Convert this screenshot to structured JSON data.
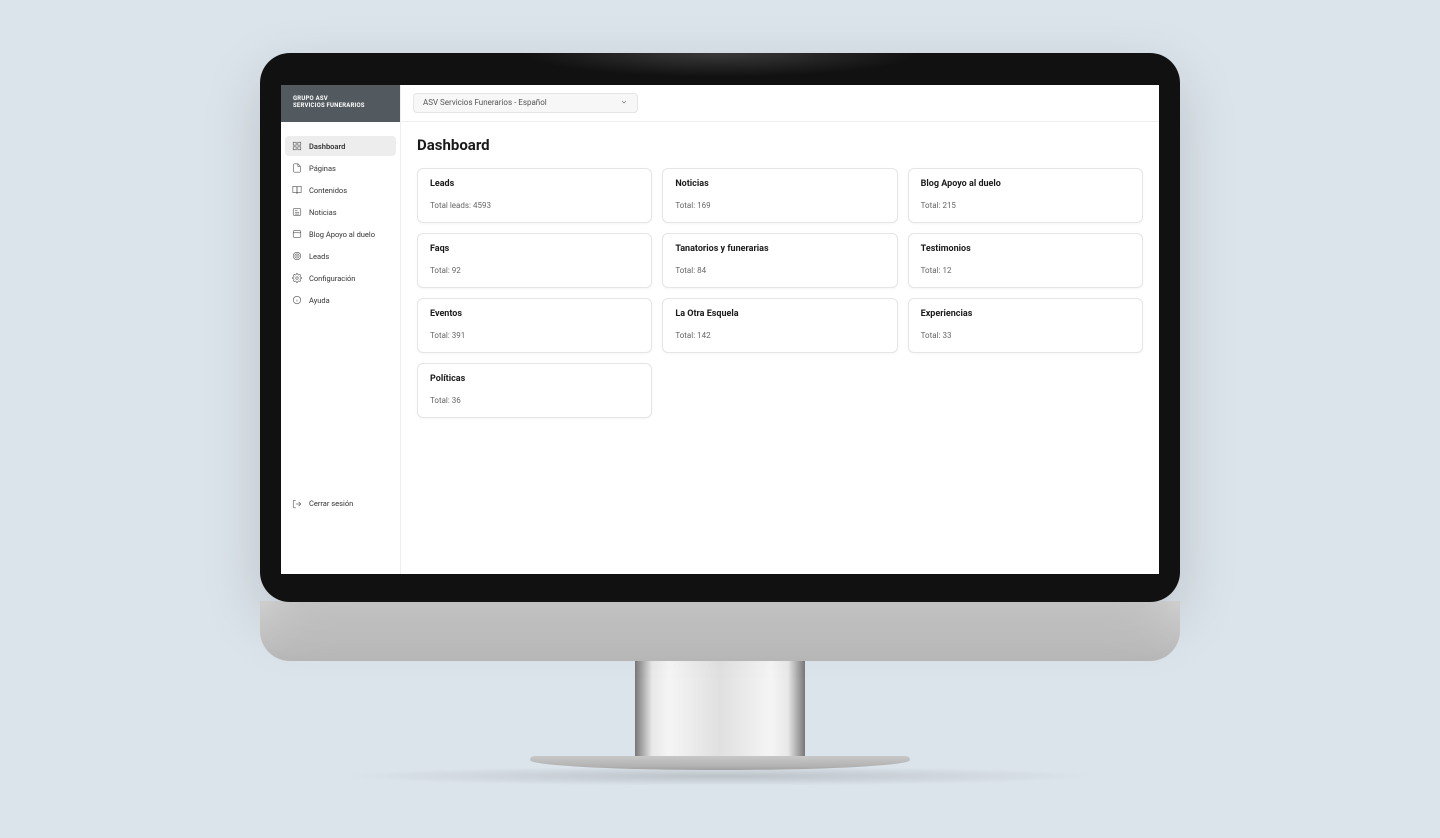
{
  "brand": {
    "line1": "GRUPO ASV",
    "line2": "SERVICIOS FUNERARIOS"
  },
  "sidebar": {
    "items": [
      {
        "label": "Dashboard",
        "active": true,
        "icon": "grid"
      },
      {
        "label": "Páginas",
        "active": false,
        "icon": "file"
      },
      {
        "label": "Contenidos",
        "active": false,
        "icon": "book"
      },
      {
        "label": "Noticias",
        "active": false,
        "icon": "news"
      },
      {
        "label": "Blog Apoyo al duelo",
        "active": false,
        "icon": "blog"
      },
      {
        "label": "Leads",
        "active": false,
        "icon": "target"
      },
      {
        "label": "Configuración",
        "active": false,
        "icon": "gear"
      },
      {
        "label": "Ayuda",
        "active": false,
        "icon": "info"
      }
    ],
    "logout_label": "Cerrar sesión"
  },
  "topbar": {
    "site_selector_value": "ASV Servicios Funerarios - Español"
  },
  "page": {
    "title": "Dashboard",
    "cards": [
      {
        "title": "Leads",
        "value_label": "Total leads: 4593"
      },
      {
        "title": "Noticias",
        "value_label": "Total: 169"
      },
      {
        "title": "Blog Apoyo al duelo",
        "value_label": "Total: 215"
      },
      {
        "title": "Faqs",
        "value_label": "Total: 92"
      },
      {
        "title": "Tanatorios y funerarias",
        "value_label": "Total: 84"
      },
      {
        "title": "Testimonios",
        "value_label": "Total: 12"
      },
      {
        "title": "Eventos",
        "value_label": "Total: 391"
      },
      {
        "title": "La Otra Esquela",
        "value_label": "Total: 142"
      },
      {
        "title": "Experiencias",
        "value_label": "Total: 33"
      },
      {
        "title": "Políticas",
        "value_label": "Total: 36"
      }
    ]
  }
}
